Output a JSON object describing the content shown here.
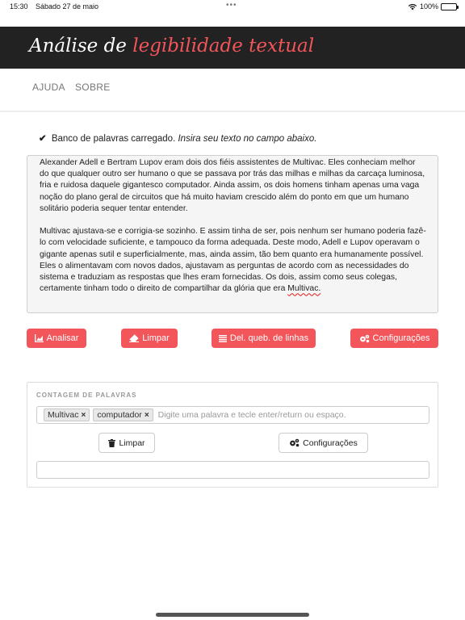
{
  "statusbar": {
    "time": "15:30",
    "date": "Sábado 27 de maio",
    "battery": "100%"
  },
  "header": {
    "title_part1": "Análise de",
    "title_part2": "legibilidade textual",
    "accent_color": "#f2555a",
    "bg_color": "#222222"
  },
  "nav": {
    "help": "AJUDA",
    "about": "SOBRE"
  },
  "status": {
    "icon": "check-icon",
    "message": "Banco de palavras carregado.",
    "hint": "Insira seu texto no campo abaixo."
  },
  "text": {
    "p1": "Alexander Adell e Bertram Lupov eram dois dos fiéis assistentes de Multivac. Eles conheciam melhor do que qualquer outro ser humano o que se passava por trás das milhas e milhas da carcaça luminosa, fria e ruidosa daquele gigantesco computador. Ainda assim, os dois homens tinham apenas uma vaga noção do plano geral de circuitos que há muito haviam crescido além do ponto em que um humano solitário poderia sequer tentar entender.",
    "p2_main": "Multivac ajustava-se e corrigia-se sozinho. E assim tinha de ser, pois nenhum ser humano poderia fazê-lo com velocidade suficiente, e tampouco da forma adequada. Deste modo, Adell e Lupov operavam o gigante apenas sutil e superficialmente, mas, ainda assim, tão bem quanto era humanamente possível. Eles o alimentavam com novos dados, ajustavam as perguntas de acordo com as necessidades do sistema e traduziam as respostas que lhes eram fornecidas. Os dois, assim como seus colegas, certamente tinham todo o direito de compartilhar da glória que era ",
    "p2_end": "Multivac."
  },
  "actions": {
    "analyze": "Analisar",
    "clear": "Limpar",
    "remove_breaks": "Del. queb. de linhas",
    "settings": "Configurações"
  },
  "word_count": {
    "heading": "CONTAGEM DE PALAVRAS",
    "tags": [
      "Multivac",
      "computador"
    ],
    "tag_remove": "×",
    "placeholder": "Digite uma palavra e tecle enter/return ou espaço.",
    "clear": "Limpar",
    "settings": "Configurações"
  }
}
